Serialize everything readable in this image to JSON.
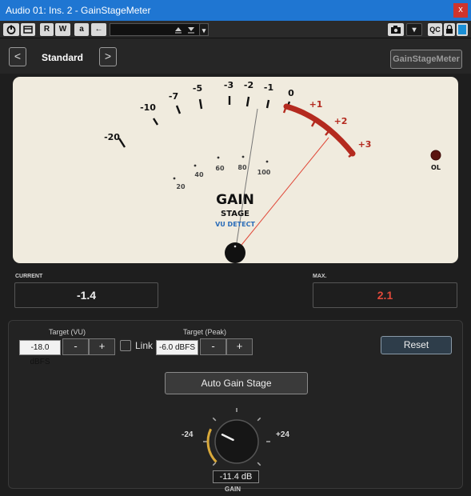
{
  "window": {
    "title": "Audio 01: Ins. 2 - GainStageMeter",
    "close_label": "x"
  },
  "toolbar": {
    "r_label": "R",
    "w_label": "W",
    "a_label": "a",
    "arrow_label": "←",
    "qc_label": "QC",
    "dropdown_label": "▾"
  },
  "header": {
    "prev_label": "<",
    "next_label": ">",
    "preset": "Standard",
    "brand": "GainStageMeter"
  },
  "meter": {
    "ticks": [
      "-20",
      "-10",
      "-7",
      "-5",
      "-3",
      "-2",
      "-1",
      "0",
      "+1",
      "+2",
      "+3"
    ],
    "peak_ticks": [
      "20",
      "40",
      "60",
      "80",
      "100"
    ],
    "title": "GAIN",
    "subtitle": "STAGE",
    "mode": "VU DETECT",
    "ol_label": "OL",
    "vu_needle_value": -1.4,
    "peak_needle_value": 2.1,
    "colors": {
      "face": "#f0ebde",
      "red": "#b42a1f",
      "accent_blue": "#2a6cb8"
    }
  },
  "values": {
    "current_label": "CURRENT",
    "current": "-1.4",
    "max_label": "MAX.",
    "max": "2.1",
    "max_color": "#e0493a"
  },
  "controls": {
    "target_vu_label": "Target (VU)",
    "target_vu": "-18.0 dBFS",
    "target_peak_label": "Target (Peak)",
    "target_peak": "-6.0 dBFS",
    "minus": "-",
    "plus": "+",
    "link_label": "Link",
    "link_checked": false,
    "reset_label": "Reset",
    "auto_gain_label": "Auto Gain Stage",
    "knob_min": "-24",
    "knob_max": "+24",
    "gain_value": "-11.4 dB",
    "gain_label": "GAIN",
    "gain_db": -11.4,
    "knob_accent": "#d9a93a"
  }
}
